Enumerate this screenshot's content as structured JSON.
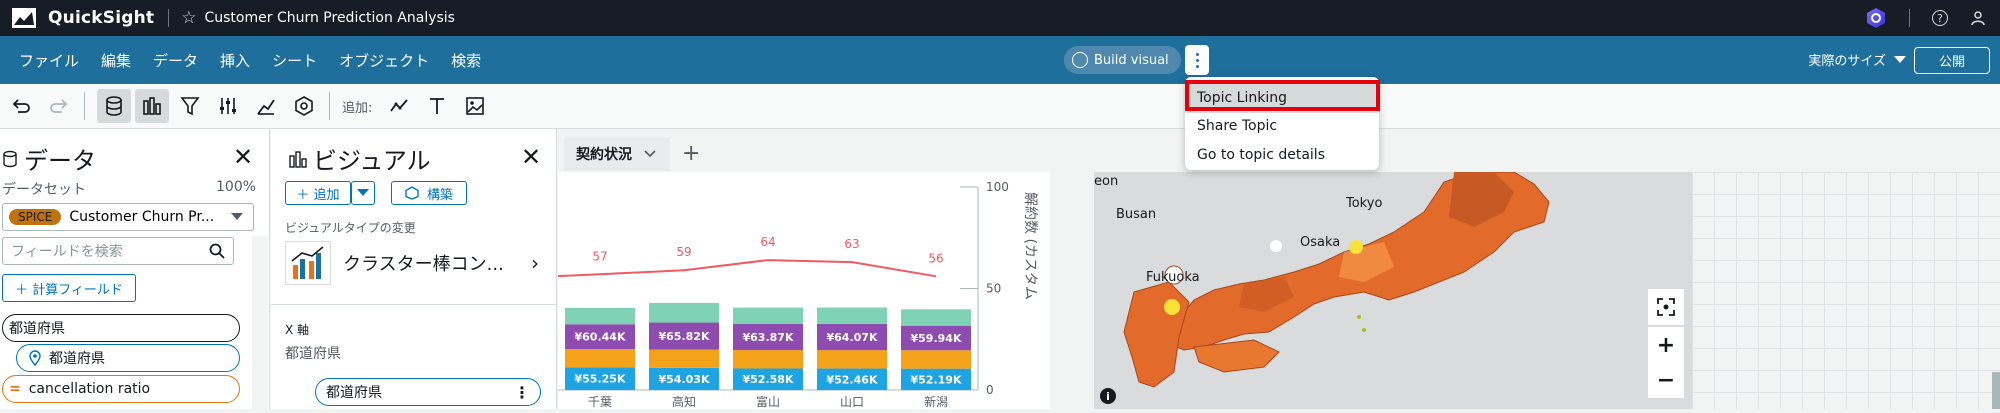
{
  "app": {
    "brand": "QuickSight",
    "analysis_title": "Customer Churn Prediction Analysis"
  },
  "menu": {
    "items": [
      "ファイル",
      "編集",
      "データ",
      "挿入",
      "シート",
      "オブジェクト",
      "検索"
    ],
    "build_visual": "Build visual",
    "zoom": "実際のサイズ",
    "publish": "公開"
  },
  "dropdown": {
    "items": [
      "Topic Linking",
      "Share Topic",
      "Go to topic details"
    ]
  },
  "toolbar": {
    "add_label": "追加:"
  },
  "data_panel": {
    "title": "データ",
    "dataset_label": "データセット",
    "dataset_pct": "100%",
    "spice_badge": "SPICE",
    "dataset_name": "Customer Churn Pr...",
    "search_placeholder": "フィールドを検索",
    "calc_field": "＋ 計算フィールド",
    "fields": [
      "都道府県",
      "都道府県",
      "cancellation ratio"
    ]
  },
  "visual_panel": {
    "title": "ビジュアル",
    "add": "＋ 追加",
    "build": "構築",
    "change_type_label": "ビジュアルタイプの変更",
    "visual_type": "クラスター棒コン...",
    "x_axis_label": "X 軸",
    "x_axis_sub": "都道府県",
    "x_field": "都道府県"
  },
  "sheet": {
    "tab": "契約状況"
  },
  "chart_data": {
    "type": "bar",
    "categories": [
      "千葉",
      "高知",
      "富山",
      "山口",
      "新潟"
    ],
    "series": [
      {
        "name": "",
        "values": [
          55.25,
          54.03,
          52.58,
          52.46,
          52.19
        ],
        "labels": [
          "¥55.25K",
          "¥54.03K",
          "¥52.58K",
          "¥52.46K",
          "¥52.19K"
        ],
        "color": "#1fa4e3"
      },
      {
        "name": "",
        "values": [
          45,
          45,
          45,
          45,
          45
        ],
        "color": "#f5a21b"
      },
      {
        "name": "",
        "values": [
          60.44,
          65.82,
          63.87,
          64.07,
          59.94
        ],
        "labels": [
          "¥60.44K",
          "¥65.82K",
          "¥63.87K",
          "¥64.07K",
          "¥59.94K"
        ],
        "color": "#8e4bb0"
      },
      {
        "name": "",
        "values": [
          40,
          48,
          40,
          40,
          40
        ],
        "color": "#7fd2b5"
      }
    ],
    "line": {
      "values": [
        57,
        59,
        64,
        63,
        56
      ],
      "color": "#ef5a63"
    },
    "y2_ticks": [
      "100",
      "50",
      "0"
    ],
    "y2_label": "解約数 (カスタム",
    "y2lim": [
      0,
      100
    ]
  },
  "map": {
    "labels": [
      "eon",
      "Busan",
      "Tokyo",
      "Osaka",
      "Fukuoka"
    ]
  }
}
